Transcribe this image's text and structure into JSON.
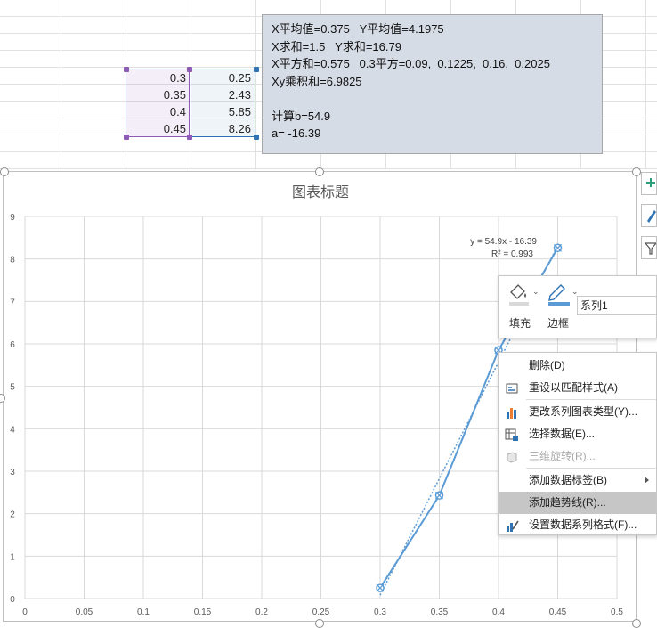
{
  "sheet": {
    "x_values": [
      "0.3",
      "0.35",
      "0.4",
      "0.45"
    ],
    "y_values": [
      "0.25",
      "2.43",
      "5.85",
      "8.26"
    ]
  },
  "note": {
    "lines": [
      "X平均值=0.375   Y平均值=4.1975",
      "X求和=1.5   Y求和=16.79",
      "X平方和=0.575   0.3平方=0.09,  0.1225,  0.16,  0.2025",
      "Xy乘积和=6.9825",
      "",
      "计算b=54.9",
      "a= -16.39"
    ]
  },
  "chart_data": {
    "type": "scatter",
    "title": "图表标题",
    "xlabel": "",
    "ylabel": "",
    "xlim": [
      0,
      0.5
    ],
    "ylim": [
      0,
      9
    ],
    "x_ticks": [
      "0",
      "0.05",
      "0.1",
      "0.15",
      "0.2",
      "0.25",
      "0.3",
      "0.35",
      "0.4",
      "0.45",
      "0.5"
    ],
    "y_ticks": [
      "0",
      "1",
      "2",
      "3",
      "4",
      "5",
      "6",
      "7",
      "8",
      "9"
    ],
    "grid": true,
    "series": [
      {
        "name": "系列1",
        "x": [
          0.3,
          0.35,
          0.4,
          0.45
        ],
        "y": [
          0.25,
          2.43,
          5.85,
          8.26
        ],
        "color": "#5b9bd5",
        "connected": true
      }
    ],
    "trendline": {
      "type": "linear",
      "slope": 54.9,
      "intercept": -16.39,
      "x_range": [
        0.3,
        0.45
      ],
      "style": "dotted"
    },
    "annotation": {
      "equation": "y = 54.9x - 16.39",
      "r2": "R² = 0.993"
    }
  },
  "format_toolbar": {
    "fill_label": "填充",
    "border_label": "边框",
    "series_selector_value": "系列1"
  },
  "context_menu": {
    "items": [
      {
        "label": "删除(D)",
        "icon": "none",
        "enabled": true
      },
      {
        "label": "重设以匹配样式(A)",
        "icon": "reset-style-icon",
        "enabled": true
      },
      {
        "label": "更改系列图表类型(Y)...",
        "icon": "chart-type-icon",
        "enabled": true
      },
      {
        "label": "选择数据(E)...",
        "icon": "select-data-icon",
        "enabled": true
      },
      {
        "label": "三维旋转(R)...",
        "icon": "rotate-3d-icon",
        "enabled": false
      },
      {
        "label": "添加数据标签(B)",
        "icon": "none",
        "enabled": true,
        "submenu": true
      },
      {
        "label": "添加趋势线(R)...",
        "icon": "none",
        "enabled": true,
        "highlighted": true
      },
      {
        "label": "设置数据系列格式(F)...",
        "icon": "format-series-icon",
        "enabled": true
      }
    ]
  },
  "colors": {
    "accent": "#5b9bd5",
    "range_x": "#8e5cb8",
    "range_y": "#2e74b5",
    "note_bg": "#d6dce5",
    "highlight": "#c6c6c6"
  }
}
